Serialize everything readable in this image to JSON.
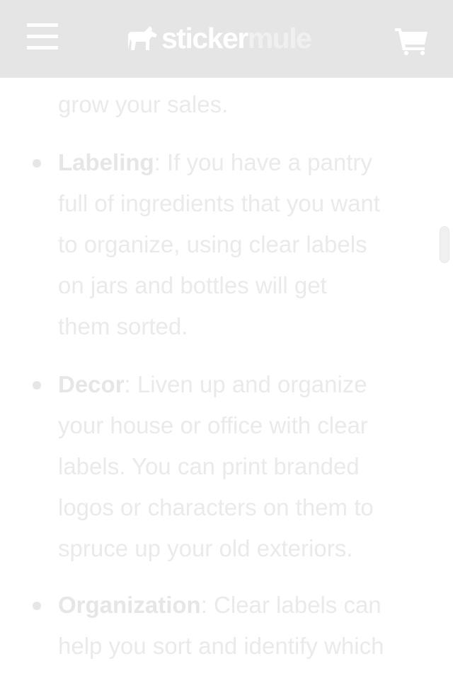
{
  "header": {
    "menu_icon": "hamburger-menu-icon",
    "logo": {
      "part1": "sticker",
      "part2": "mule",
      "icon": "mule-logo-icon"
    },
    "cart_icon": "shopping-cart-icon"
  },
  "article": {
    "previous_tail": "grow your sales.",
    "bullets": [
      {
        "term": "Labeling",
        "lines": [
          ": If you have a pantry",
          "full of ingredients that you want",
          "to organize, using clear labels",
          "on jars and bottles will get",
          "them sorted."
        ]
      },
      {
        "term": "Decor",
        "lines": [
          ": Liven up and organize",
          "your house or office with clear",
          "labels. You can print branded",
          "logos or characters on them to",
          "spruce up your old exteriors."
        ]
      },
      {
        "term": "Organization",
        "lines": [
          ": Clear labels can",
          "help you sort and identify which"
        ]
      }
    ]
  },
  "colors": {
    "header_bg": "#e5e5e5",
    "text": "#eaeaea",
    "logo_primary": "#ffffff"
  }
}
